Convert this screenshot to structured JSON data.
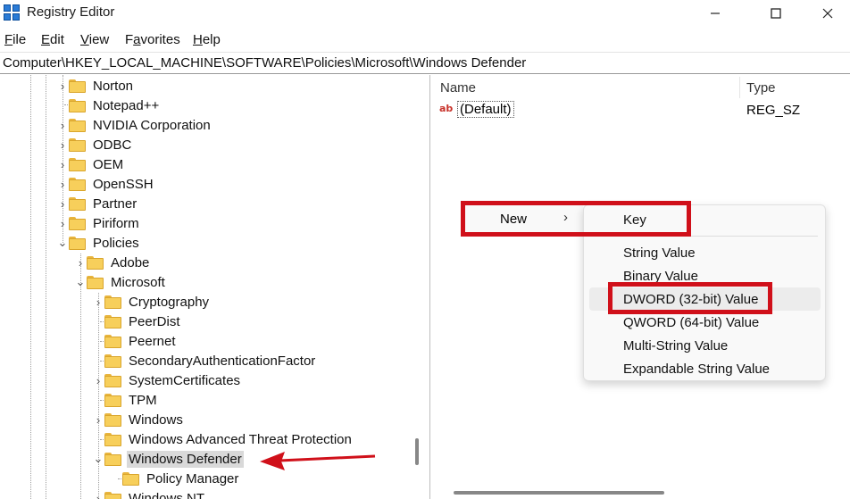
{
  "window": {
    "title": "Registry Editor",
    "buttons": [
      "–",
      "▢",
      "✕"
    ]
  },
  "menubar": {
    "items": [
      {
        "prefix": "",
        "key": "F",
        "suffix": "ile"
      },
      {
        "prefix": "",
        "key": "E",
        "suffix": "dit"
      },
      {
        "prefix": "",
        "key": "V",
        "suffix": "iew"
      },
      {
        "prefix": "F",
        "key": "a",
        "suffix": "vorites"
      },
      {
        "prefix": "",
        "key": "H",
        "suffix": "elp"
      }
    ]
  },
  "address": "Computer\\HKEY_LOCAL_MACHINE\\SOFTWARE\\Policies\\Microsoft\\Windows Defender",
  "tree": [
    {
      "label": "Norton",
      "chev": "›"
    },
    {
      "label": "Notepad++",
      "chev": ""
    },
    {
      "label": "NVIDIA Corporation",
      "chev": "›"
    },
    {
      "label": "ODBC",
      "chev": "›"
    },
    {
      "label": "OEM",
      "chev": "›"
    },
    {
      "label": "OpenSSH",
      "chev": "›"
    },
    {
      "label": "Partner",
      "chev": "›"
    },
    {
      "label": "Piriform",
      "chev": "›"
    },
    {
      "label": "Policies",
      "chev": "⌄"
    },
    {
      "label": "Adobe",
      "chev": "›"
    },
    {
      "label": "Microsoft",
      "chev": "⌄"
    },
    {
      "label": "Cryptography",
      "chev": "›"
    },
    {
      "label": "PeerDist",
      "chev": ""
    },
    {
      "label": "Peernet",
      "chev": ""
    },
    {
      "label": "SecondaryAuthenticationFactor",
      "chev": ""
    },
    {
      "label": "SystemCertificates",
      "chev": "›"
    },
    {
      "label": "TPM",
      "chev": ""
    },
    {
      "label": "Windows",
      "chev": "›"
    },
    {
      "label": "Windows Advanced Threat Protection",
      "chev": ""
    },
    {
      "label": "Windows Defender",
      "chev": "⌄"
    },
    {
      "label": "Policy Manager",
      "chev": ""
    },
    {
      "label": "Windows NT",
      "chev": "›"
    }
  ],
  "list": {
    "headers": {
      "name": "Name",
      "type": "Type"
    },
    "rows": [
      {
        "icon": "ab",
        "name": "(Default)",
        "type": "REG_SZ"
      }
    ]
  },
  "context_menu": {
    "new_label": "New",
    "new_arrow": "›",
    "submenu": {
      "key": "Key",
      "values": [
        "String Value",
        "Binary Value",
        "DWORD (32-bit) Value",
        "QWORD (64-bit) Value",
        "Multi-String Value",
        "Expandable String Value"
      ]
    }
  },
  "colors": {
    "annotation_red": "#d0101a",
    "folder_yellow": "#f7cf5b",
    "selection_gray": "#d9d9d9"
  }
}
